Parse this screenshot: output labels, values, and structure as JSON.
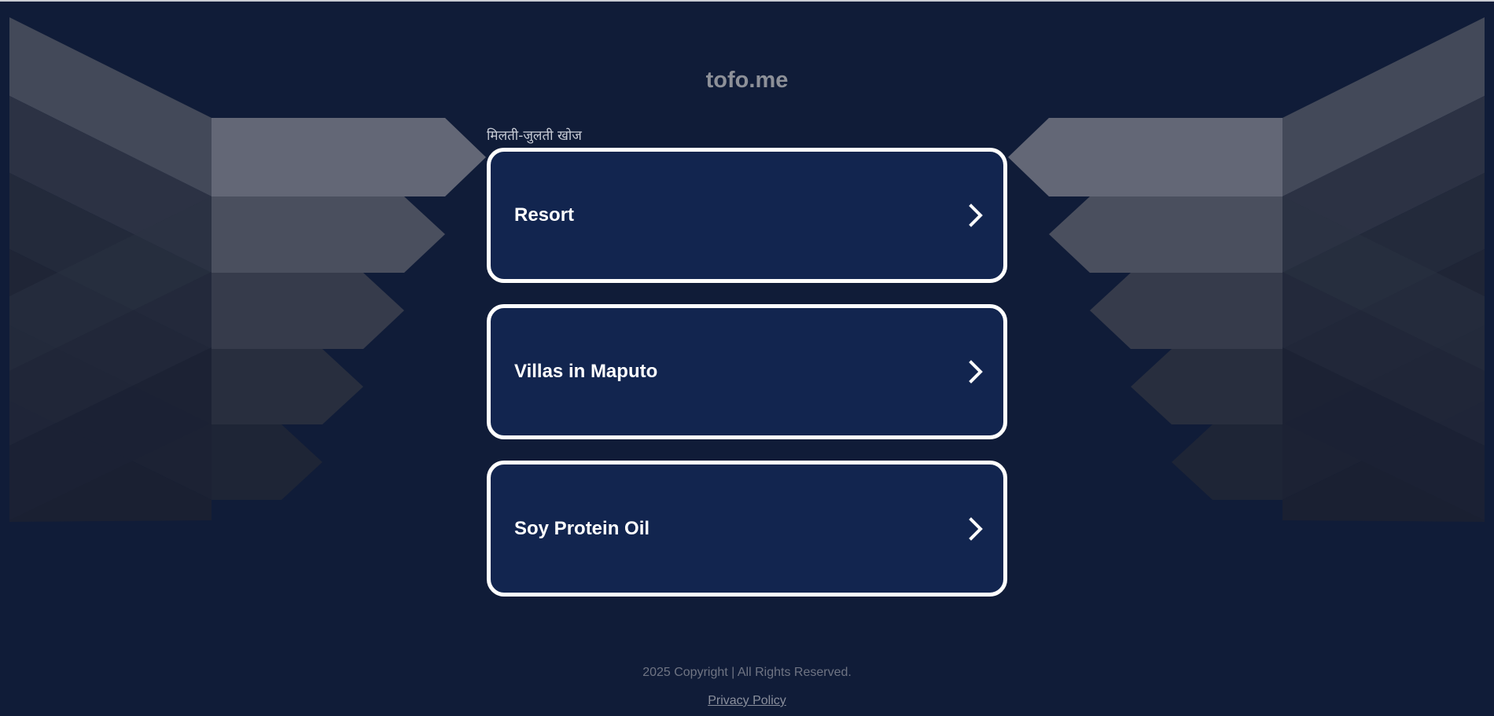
{
  "header": {
    "domain": "tofo.me"
  },
  "search": {
    "label": "मिलती-जुलती खोज"
  },
  "links": [
    {
      "label": "Resort"
    },
    {
      "label": "Villas in Maputo"
    },
    {
      "label": "Soy Protein Oil"
    }
  ],
  "footer": {
    "copyright": "2025 Copyright | All Rights Reserved.",
    "privacy_label": "Privacy Policy"
  },
  "colors": {
    "background": "#101c38",
    "card_background": "#12254f",
    "card_border": "#ffffff",
    "domain_text": "#8d9098"
  },
  "icons": {
    "link_arrow": "chevron-right-icon"
  }
}
